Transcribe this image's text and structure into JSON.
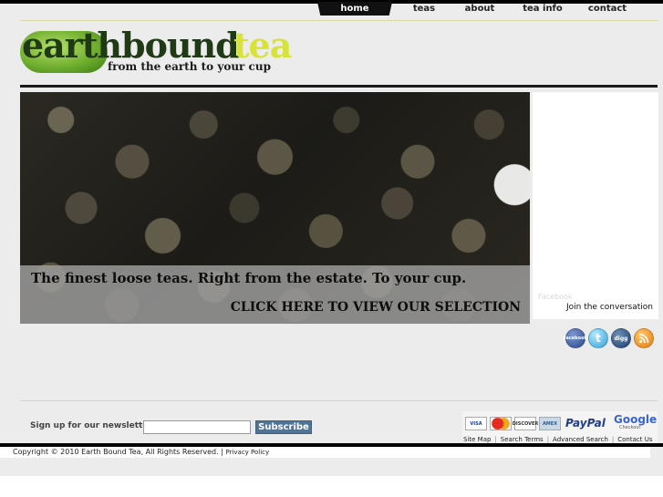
{
  "nav": {
    "items": [
      {
        "label": "home",
        "active": true
      },
      {
        "label": "teas",
        "active": false
      },
      {
        "label": "about",
        "active": false
      },
      {
        "label": "tea info",
        "active": false
      },
      {
        "label": "contact",
        "active": false
      }
    ]
  },
  "logo": {
    "word1": "earthbound",
    "word2": "tea",
    "tagline": "from the earth to your cup"
  },
  "hero": {
    "line1": "The finest loose teas. Right from the estate. To your cup.",
    "line2": "CLICK HERE TO VIEW OUR SELECTION"
  },
  "side": {
    "faint_text": "Facebook",
    "join": "Join the conversation"
  },
  "social": [
    {
      "name": "facebook",
      "icon": "facebook-icon",
      "text": "facebook"
    },
    {
      "name": "twitter",
      "icon": "twitter-icon",
      "text": "t"
    },
    {
      "name": "digg",
      "icon": "digg-icon",
      "text": "digg"
    },
    {
      "name": "rss",
      "icon": "rss-icon",
      "text": ""
    }
  ],
  "newsletter": {
    "label": "Sign up for our newsletter:",
    "input_value": "",
    "button": "Subscribe"
  },
  "payment": {
    "visa": "VISA",
    "mastercard": "MasterCard",
    "discover": "DISCOVER",
    "amex": "AMEX",
    "paypal": "PayPal",
    "google": "Google",
    "google_sub": "Checkout"
  },
  "footer_links": [
    "Site Map",
    "Search Terms",
    "Advanced Search",
    "Contact Us"
  ],
  "copyright": {
    "text": "Copyright © 2010 Earth Bound Tea, All Rights Reserved. |",
    "privacy": "Privacy Policy"
  },
  "colors": {
    "button_blue": "#4f7598",
    "logo_dark": "#1f3a14",
    "logo_yellow": "#d8e33a"
  }
}
